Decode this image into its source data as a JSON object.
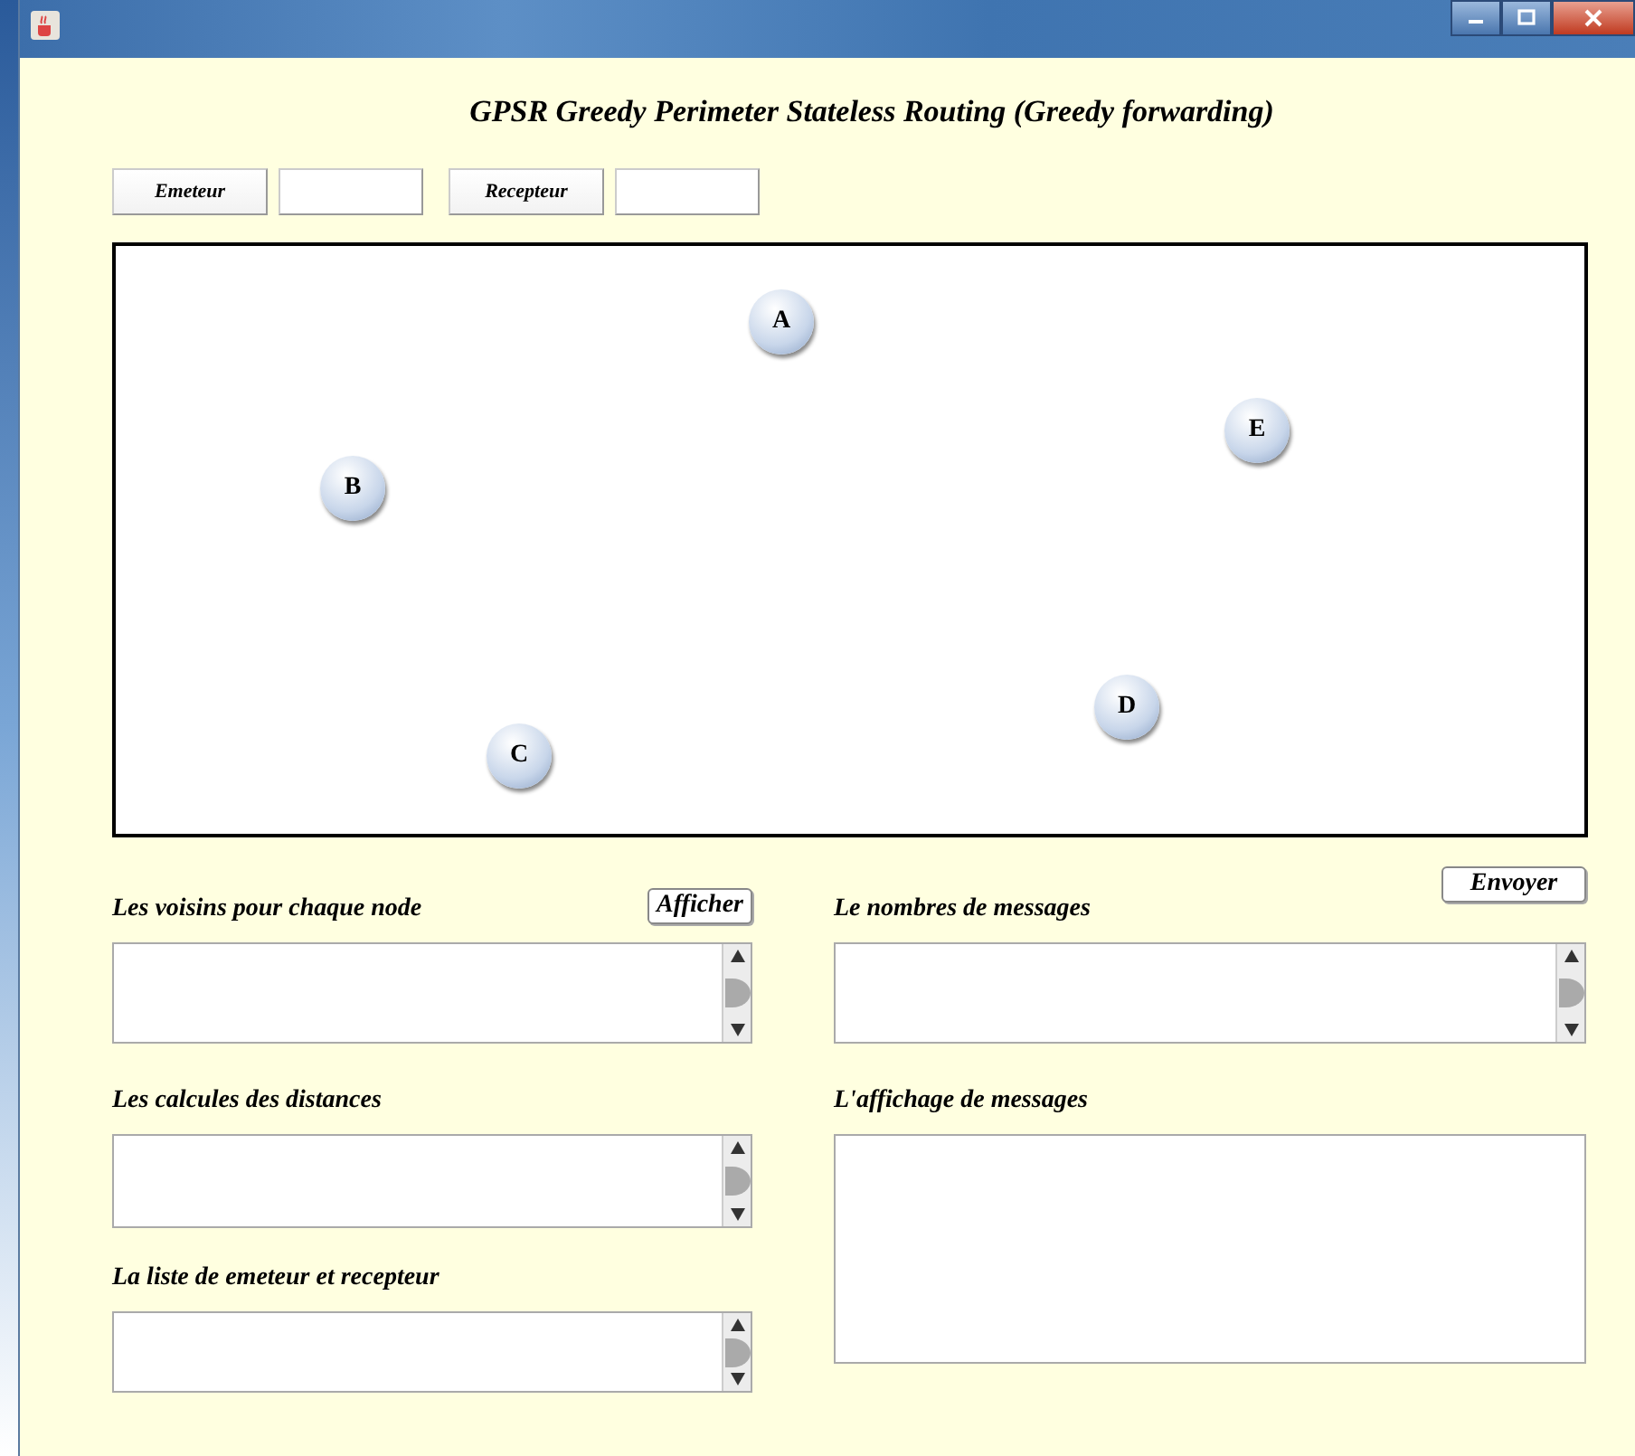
{
  "heading": "GPSR Greedy Perimeter Stateless Routing (Greedy forwarding)",
  "endpoints": [
    {
      "button": "Emeteur"
    },
    {
      "button": "Recepteur"
    }
  ],
  "nodes": [
    {
      "label": "A"
    },
    {
      "label": "B"
    },
    {
      "label": "C"
    },
    {
      "label": "E"
    },
    {
      "label": "D"
    }
  ],
  "left_panels": [
    {
      "label": "Les voisins pour chaque node",
      "button": "Afficher",
      "scroll": true
    },
    {
      "label": "Les calcules des distances",
      "scroll": true
    },
    {
      "label": "La liste de emeteur et recepteur",
      "scroll": true
    }
  ],
  "right_panels": [
    {
      "label": "Le nombres de messages",
      "button": "Envoyer",
      "scroll": true
    },
    {
      "label": "L'affichage de messages",
      "scroll": false
    }
  ]
}
